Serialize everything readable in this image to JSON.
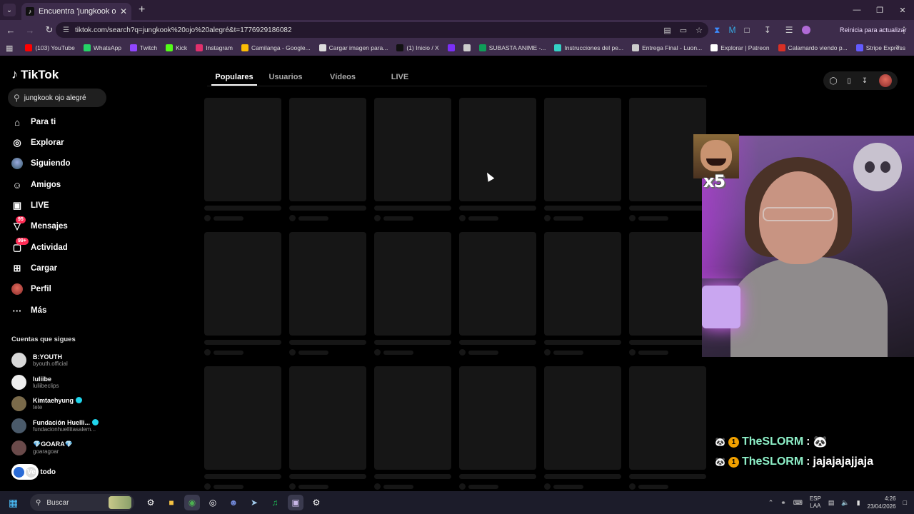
{
  "browser": {
    "tab_title": "Encuentra 'jungkook ojo alegré'",
    "url": "tiktok.com/search?q=jungkook%20ojo%20alegré&t=1776929186082",
    "update_label": "Reinicia para actualizar",
    "bookmarks": [
      {
        "label": "(103) YouTube",
        "color": "#ff0000"
      },
      {
        "label": "WhatsApp",
        "color": "#25d366"
      },
      {
        "label": "Twitch",
        "color": "#9146ff"
      },
      {
        "label": "Kick",
        "color": "#53fc18"
      },
      {
        "label": "Instagram",
        "color": "#e1306c"
      },
      {
        "label": "Camilanga - Google...",
        "color": "#fbbc04"
      },
      {
        "label": "Cargar imagen para...",
        "color": "#dddddd"
      },
      {
        "label": "(1) Inicio / X",
        "color": "#111111"
      },
      {
        "label": "",
        "color": "#7b2ff7"
      },
      {
        "label": "",
        "color": "#cccccc"
      },
      {
        "label": "SUBASTA ANIME -...",
        "color": "#0f9d58"
      },
      {
        "label": "Instrucciones del pe...",
        "color": "#34d1c4"
      },
      {
        "label": "Entrega Final - Luon...",
        "color": "#cccccc"
      },
      {
        "label": "Explorar | Patreon",
        "color": "#ffffff"
      },
      {
        "label": "Calamardo viendo p...",
        "color": "#d93025"
      },
      {
        "label": "Stripe Express",
        "color": "#635bff"
      }
    ]
  },
  "tiktok": {
    "logo": "TikTok",
    "search_value": "jungkook ojo alegré",
    "nav": [
      {
        "label": "Para ti",
        "icon": "home-icon",
        "glyph": "⌂"
      },
      {
        "label": "Explorar",
        "icon": "compass-icon",
        "glyph": "◎"
      },
      {
        "label": "Siguiendo",
        "icon": "following-avatar-icon",
        "glyph": "◉"
      },
      {
        "label": "Amigos",
        "icon": "friends-icon",
        "glyph": "☺"
      },
      {
        "label": "LIVE",
        "icon": "live-icon",
        "glyph": "▣"
      },
      {
        "label": "Mensajes",
        "icon": "messages-icon",
        "glyph": "▽",
        "badge": "95"
      },
      {
        "label": "Actividad",
        "icon": "activity-icon",
        "glyph": "▢",
        "badge": "99+"
      },
      {
        "label": "Cargar",
        "icon": "upload-icon",
        "glyph": "⊞"
      },
      {
        "label": "Perfil",
        "icon": "profile-avatar-icon",
        "glyph": ""
      },
      {
        "label": "Más",
        "icon": "more-icon",
        "glyph": "···"
      }
    ],
    "following_title": "Cuentas que sigues",
    "following": [
      {
        "name": "B:YOUTH",
        "handle": "byouth.official",
        "verified": false,
        "color": "#d8d8d8"
      },
      {
        "name": "luliibe",
        "handle": "luliibeclips",
        "verified": false,
        "color": "#eeeeee"
      },
      {
        "name": "Kimtaehyung",
        "handle": "tete",
        "verified": true,
        "color": "#7a6a4a"
      },
      {
        "name": "Fundación Huelli...",
        "handle": "fundacionhuellitasalem...",
        "verified": true,
        "color": "#4a5a6a"
      },
      {
        "name": "💎GOARA💎",
        "handle": "goaragoar",
        "verified": false,
        "color": "#6a4a4a"
      }
    ],
    "see_all": "Ver todo",
    "tabs": [
      "Populares",
      "Usuarios",
      "Vídeos",
      "LIVE"
    ],
    "active_tab": "Populares"
  },
  "stream": {
    "meme_count": "x5",
    "chat": [
      {
        "user": "TheSLORM",
        "message": "🐼"
      },
      {
        "user": "TheSLORM",
        "message": "jajajajajjaja"
      }
    ]
  },
  "taskbar": {
    "search_label": "Buscar",
    "lang_line1": "ESP",
    "lang_line2": "LAA",
    "time": "4:26",
    "date": "23/04/2026"
  }
}
